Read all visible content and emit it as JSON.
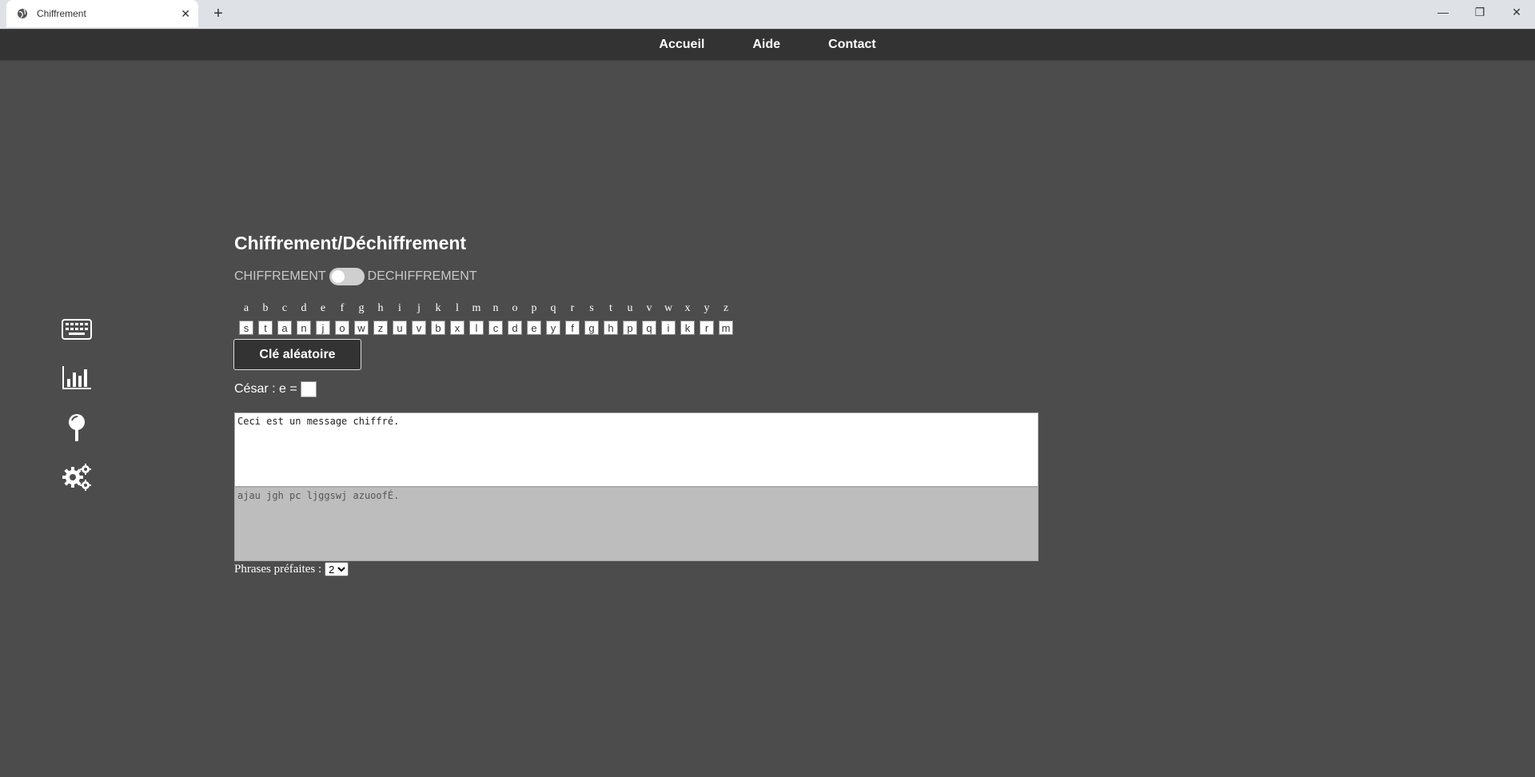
{
  "browser": {
    "tab_title": "Chiffrement",
    "tab_close": "✕",
    "new_tab": "+",
    "minimize": "—",
    "restore": "❐",
    "close": "✕"
  },
  "nav": {
    "items": [
      "Accueil",
      "Aide",
      "Contact"
    ]
  },
  "sidebar": {
    "icons": [
      "keyboard-icon",
      "bar-chart-icon",
      "magnifier-icon",
      "gears-icon"
    ]
  },
  "main": {
    "heading": "Chiffrement/Déchiffrement",
    "mode_left": "CHIFFREMENT",
    "mode_right": "DECHIFFREMENT",
    "alphabet": [
      "a",
      "b",
      "c",
      "d",
      "e",
      "f",
      "g",
      "h",
      "i",
      "j",
      "k",
      "l",
      "m",
      "n",
      "o",
      "p",
      "q",
      "r",
      "s",
      "t",
      "u",
      "v",
      "w",
      "x",
      "y",
      "z"
    ],
    "key": [
      "s",
      "t",
      "a",
      "n",
      "j",
      "o",
      "w",
      "z",
      "u",
      "v",
      "b",
      "x",
      "l",
      "c",
      "d",
      "e",
      "y",
      "f",
      "g",
      "h",
      "p",
      "q",
      "i",
      "k",
      "r",
      "m"
    ],
    "random_key_button": "Clé aléatoire",
    "cesar_label": "César : e =",
    "cesar_value": "",
    "plaintext": "Ceci est un message chiffré.",
    "ciphertext": "ajau jgh pc ljggswj azuoofÉ.",
    "prefab_label": "Phrases préfaites :",
    "prefab_selected": "2"
  }
}
